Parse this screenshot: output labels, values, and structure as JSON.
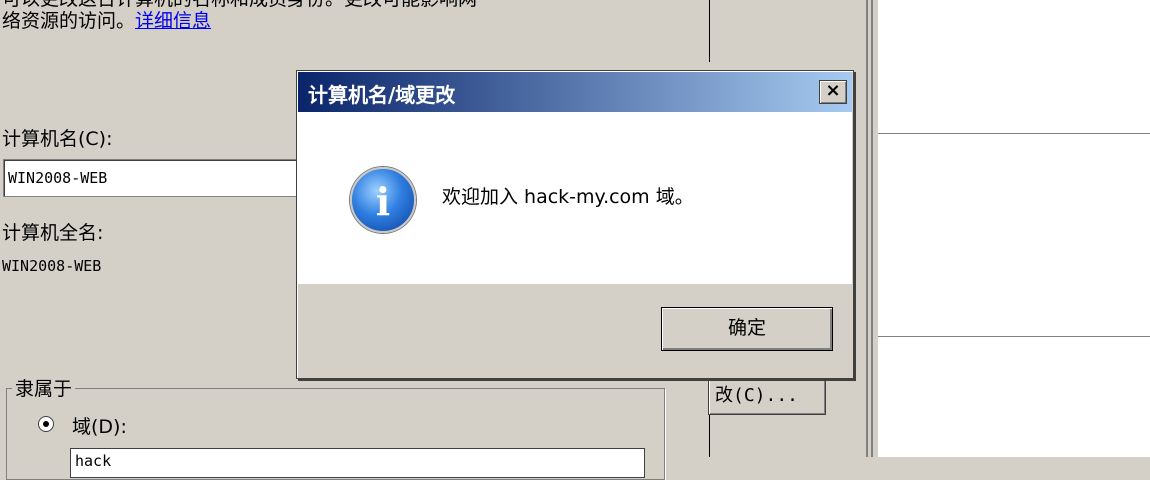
{
  "properties": {
    "description_line1": "可以更改这台计算机的名称和成员身份。更改可能影响网",
    "description_line2": "络资源的访问。",
    "details_link": "详细信息",
    "computer_name_label": "计算机名(C):",
    "computer_name_value": "WIN2008-WEB",
    "full_name_label": "计算机全名:",
    "full_name_value": "WIN2008-WEB",
    "member_of_legend": "隶属于",
    "domain_label": "域(D):",
    "domain_value": "hack",
    "change_button": "改(C)..."
  },
  "message_box": {
    "title": "计算机名/域更改",
    "close_label": "×",
    "message": "欢迎加入 hack-my.com 域。",
    "ok_button": "确定",
    "icon": "info-icon"
  }
}
